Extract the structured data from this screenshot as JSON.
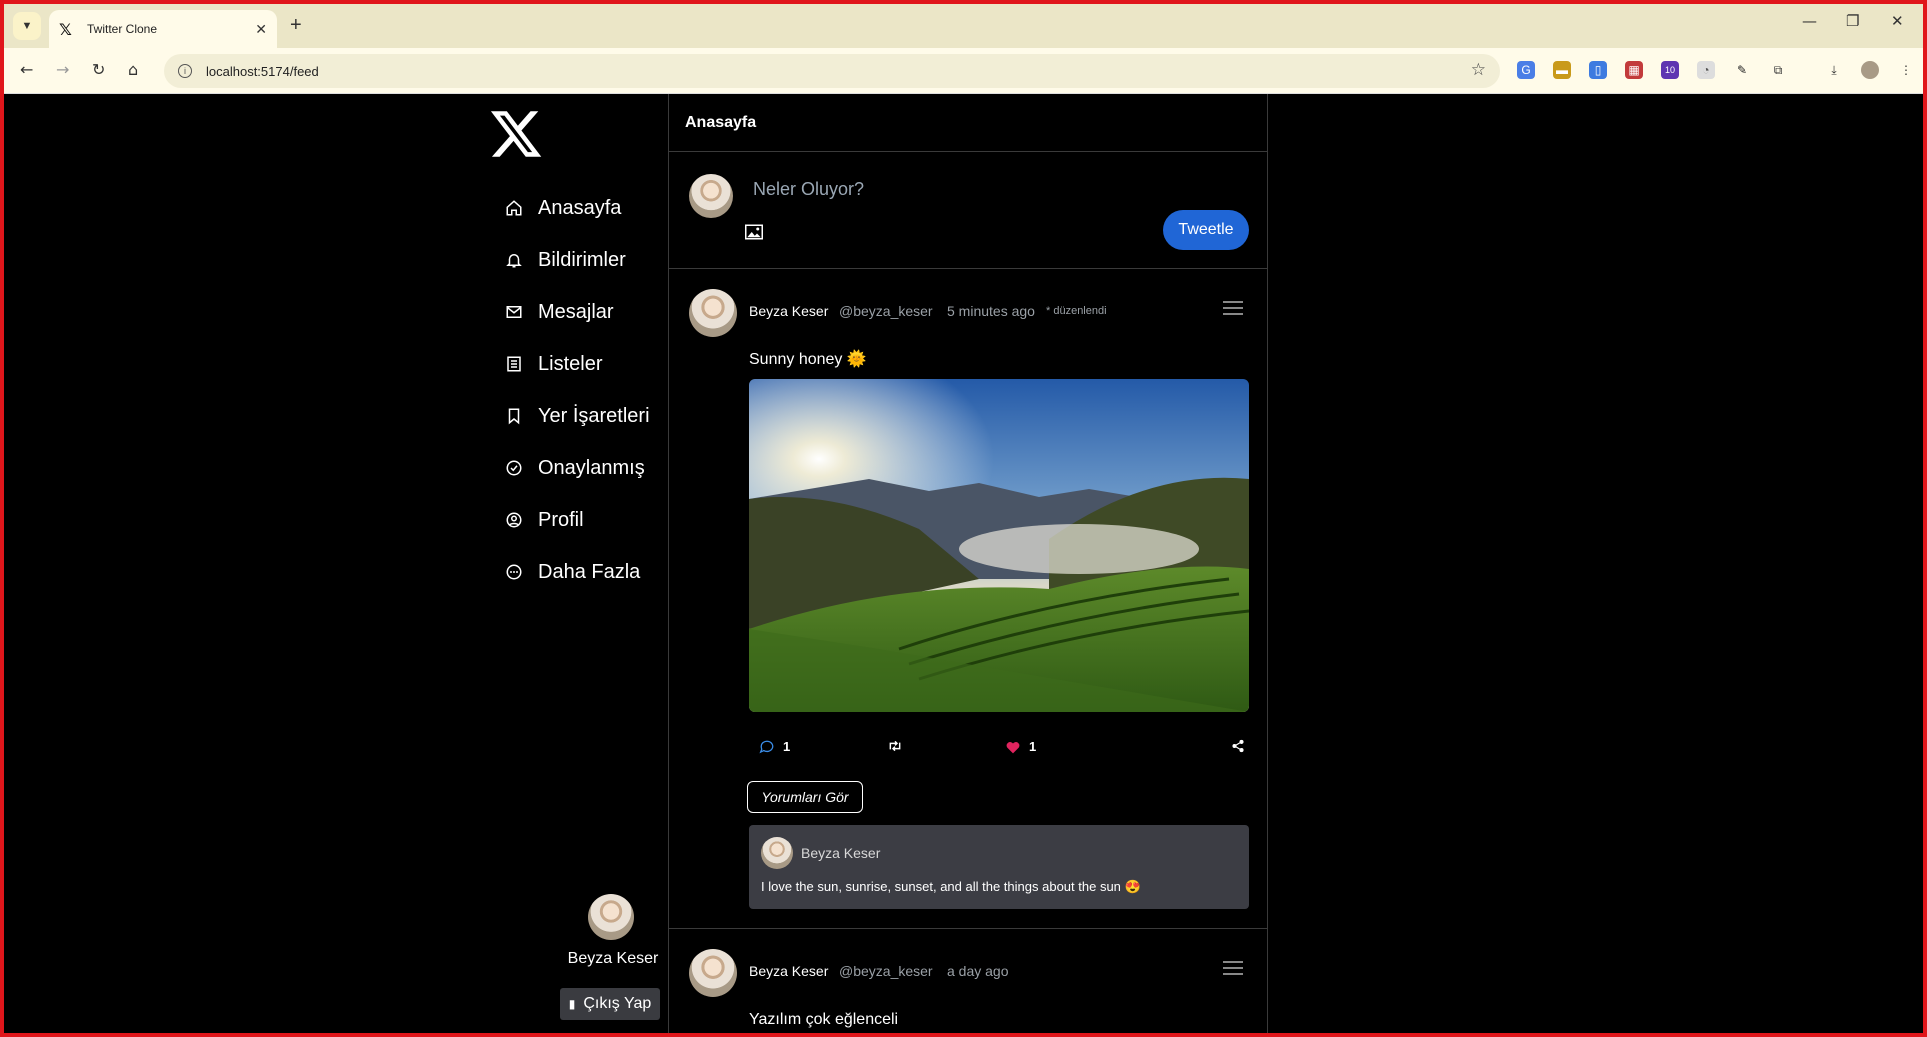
{
  "browser": {
    "tab_title": "Twitter Clone",
    "tab_icon": "x-logo-icon",
    "url": "localhost:5174/feed",
    "extension_badge": "10"
  },
  "sidebar": {
    "logo": "x-logo-icon",
    "items": [
      {
        "label": "Anasayfa",
        "icon": "home-icon"
      },
      {
        "label": "Bildirimler",
        "icon": "bell-icon"
      },
      {
        "label": "Mesajlar",
        "icon": "mail-icon"
      },
      {
        "label": "Listeler",
        "icon": "list-icon"
      },
      {
        "label": "Yer İşaretleri",
        "icon": "bookmark-icon"
      },
      {
        "label": "Onaylanmış",
        "icon": "check-circle-icon"
      },
      {
        "label": "Profil",
        "icon": "user-circle-icon"
      },
      {
        "label": "Daha Fazla",
        "icon": "more-circle-icon"
      }
    ],
    "user_name": "Beyza Keser",
    "logout_label": "Çıkış Yap"
  },
  "feed": {
    "title": "Anasayfa",
    "composer": {
      "placeholder": "Neler Oluyor?",
      "submit_label": "Tweetle"
    },
    "posts": [
      {
        "name": "Beyza Keser",
        "handle": "@beyza_keser",
        "time": "5 minutes ago",
        "edited": "* düzenlendi",
        "text": "Sunny honey 🌞",
        "comment_count": "1",
        "like_count": "1",
        "see_comments_label": "Yorumları Gör",
        "comment": {
          "name": "Beyza Keser",
          "text": "I love the sun, sunrise, sunset, and all the things about the sun 😍"
        }
      },
      {
        "name": "Beyza Keser",
        "handle": "@beyza_keser",
        "time": "a day ago",
        "text": "Yazılım çok eğlenceli"
      }
    ]
  },
  "colors": {
    "accent": "#2066d6",
    "like": "#e0245e",
    "reply": "#3b8eea",
    "comment_bg": "#3c3d44"
  }
}
